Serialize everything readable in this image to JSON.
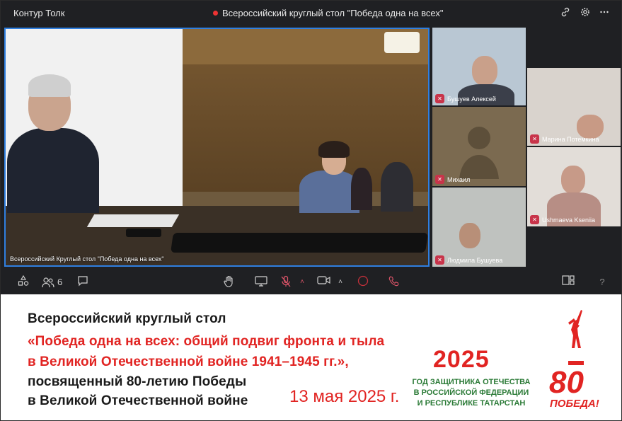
{
  "app": {
    "name": "Контур Толк"
  },
  "meeting": {
    "title": "Всероссийский круглый стол \"Победа одна на всех\"",
    "recording_color": "#e33333"
  },
  "main_video": {
    "label": "Всероссийский Круглый стол \"Победа одна на всех\""
  },
  "tiles": [
    {
      "name": "Бушуев Алексей",
      "mic": "muted"
    },
    {
      "name": "Марина Потемкина",
      "mic": "muted"
    },
    {
      "name": "Михаил",
      "mic": "muted"
    },
    {
      "name": "Ushmaeva Kseniia",
      "mic": "muted"
    },
    {
      "name": "Людмила Бушуева",
      "mic": "muted"
    }
  ],
  "controls": {
    "participants_count": "6",
    "help": "?"
  },
  "banner": {
    "line1": "Всероссийский круглый стол",
    "line2": "«Победа одна на всех: общий подвиг фронта и тыла",
    "line3": "в Великой Отечественной войне 1941–1945 гг.»,",
    "line4": "посвященный 80-летию Победы",
    "line5": "в Великой Отечественной войне",
    "date": "13 мая 2025 г.",
    "year": "2025",
    "year_of_1": "ГОД ЗАЩИТНИКА ОТЕЧЕСТВА",
    "year_of_2": "В РОССИЙСКОЙ ФЕДЕРАЦИИ",
    "year_of_3": "И РЕСПУБЛИКЕ ТАТАРСТАН",
    "logo_number": "80",
    "logo_word": "ПОБЕДА!",
    "accent_red": "#e12422",
    "accent_green": "#2a7a36"
  }
}
